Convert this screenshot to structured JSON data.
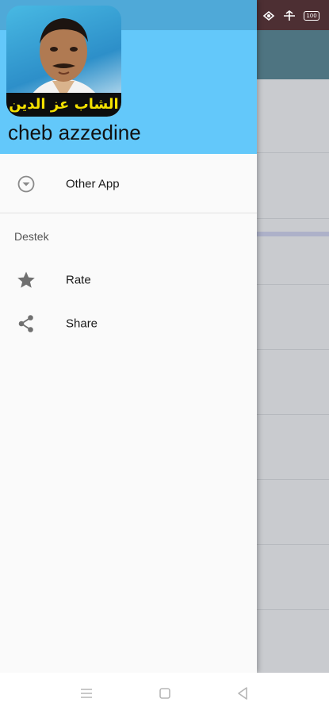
{
  "status_bar": {
    "battery_text": "100"
  },
  "drawer": {
    "header": {
      "avatar_caption": "الشاب عز الدين",
      "app_name": "cheb azzedine",
      "header_color": "#63c8fa"
    },
    "items": [
      {
        "label": "Other App",
        "icon": "chevron-down-circle-icon"
      }
    ],
    "section": {
      "title": "Destek",
      "items": [
        {
          "label": "Rate",
          "icon": "star-icon"
        },
        {
          "label": "Share",
          "icon": "share-icon"
        }
      ]
    }
  },
  "nav_bar": {
    "buttons": [
      "menu-icon",
      "home-square-icon",
      "back-triangle-icon"
    ]
  }
}
